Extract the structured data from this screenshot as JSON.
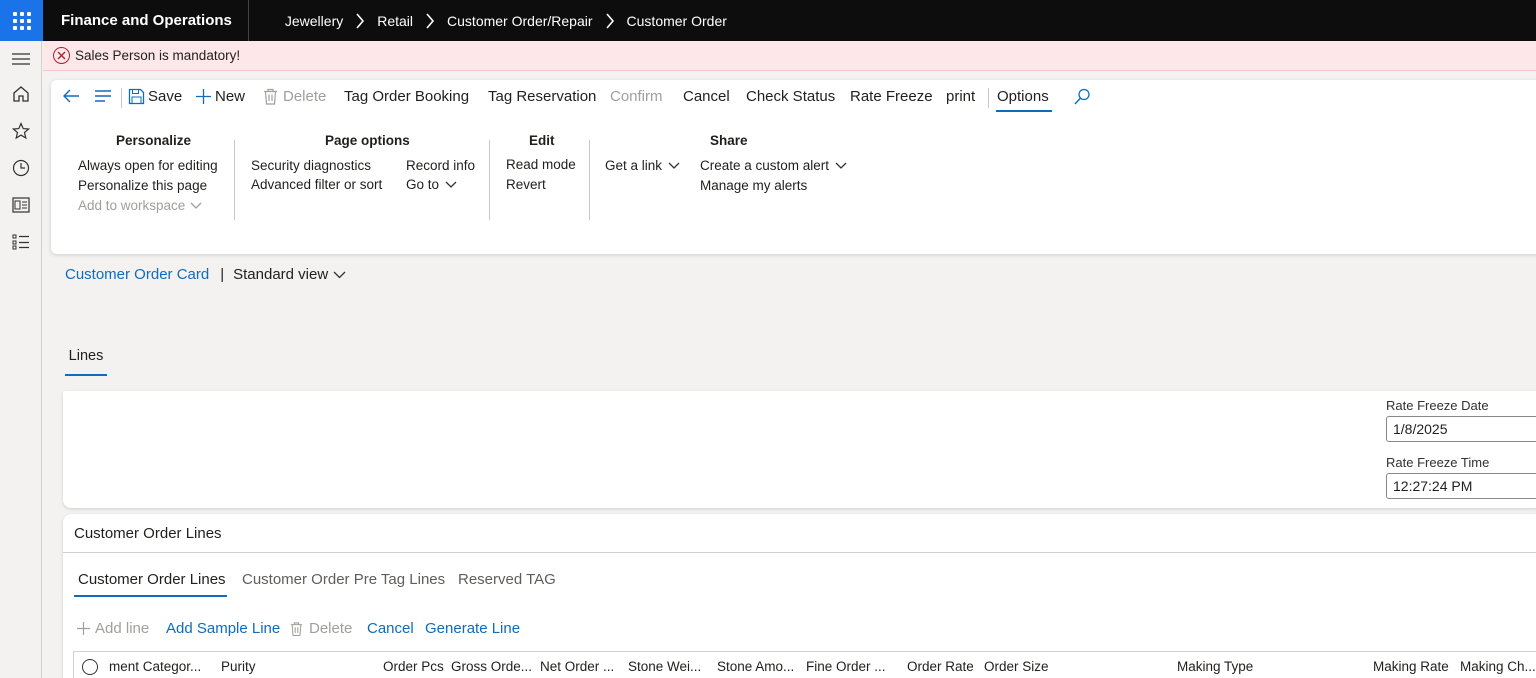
{
  "app": {
    "title": "Finance and Operations",
    "breadcrumbs": [
      "Jewellery",
      "Retail",
      "Customer Order/Repair",
      "Customer Order"
    ]
  },
  "error": {
    "message": "Sales Person is mandatory!"
  },
  "toolbar": {
    "save": "Save",
    "new": "New",
    "delete": "Delete",
    "tag_order_booking": "Tag Order Booking",
    "tag_reservation": "Tag Reservation",
    "confirm": "Confirm",
    "cancel": "Cancel",
    "check_status": "Check Status",
    "rate_freeze": "Rate Freeze",
    "print": "print",
    "options": "Options"
  },
  "options_menu": {
    "personalize": {
      "title": "Personalize",
      "items": [
        "Always open for editing",
        "Personalize this page",
        "Add to workspace"
      ]
    },
    "page_options": {
      "title": "Page options",
      "items": [
        "Security diagnostics",
        "Advanced filter or sort",
        "Record info",
        "Go to"
      ]
    },
    "edit": {
      "title": "Edit",
      "items": [
        "Read mode",
        "Revert"
      ]
    },
    "share": {
      "title": "Share",
      "items": [
        "Get a link",
        "Create a custom alert",
        "Manage my alerts"
      ]
    }
  },
  "view": {
    "page_name": "Customer Order Card",
    "separator": "|",
    "view_name": "Standard view"
  },
  "tabs": {
    "lines": "Lines"
  },
  "rate_freeze": {
    "date_label": "Rate Freeze Date",
    "date_value": "1/8/2025",
    "time_label": "Rate Freeze Time",
    "time_value": "12:27:24 PM"
  },
  "lines_section": {
    "title": "Customer Order Lines",
    "subtabs": [
      "Customer Order Lines",
      "Customer Order Pre Tag Lines",
      "Reserved TAG"
    ],
    "actions": {
      "add_line": "Add line",
      "add_sample_line": "Add Sample Line",
      "delete": "Delete",
      "cancel": "Cancel",
      "generate_line": "Generate Line"
    },
    "columns": [
      "ment Categor...",
      "Purity",
      "Order Pcs",
      "Gross Orde...",
      "Net Order ...",
      "Stone Wei...",
      "Stone Amo...",
      "Fine Order ...",
      "Order Rate",
      "Order Size",
      "Making Type",
      "Making Rate",
      "Making Ch..."
    ]
  },
  "colors": {
    "topbar": "#0d0d0d",
    "waffle": "#1a73e8",
    "accent": "#0f6cbd",
    "error_bg": "#fde7e9",
    "error_icon": "#a4262c"
  },
  "icons": [
    "waffle-icon",
    "hamburger-icon",
    "home-icon",
    "star-icon",
    "clock-icon",
    "workspace-icon",
    "list-icon",
    "back-icon",
    "lines-icon",
    "save-icon",
    "plus-icon",
    "trash-icon",
    "search-icon",
    "chevron-down-icon",
    "error-icon"
  ]
}
